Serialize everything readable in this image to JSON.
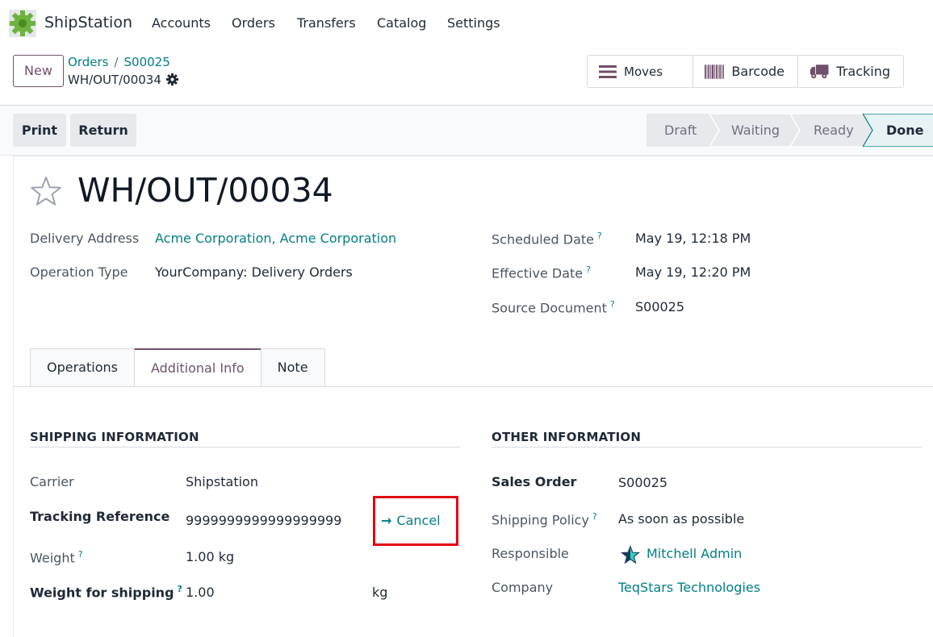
{
  "navbar": {
    "app_name": "ShipStation",
    "menu": [
      "Accounts",
      "Orders",
      "Transfers",
      "Catalog",
      "Settings"
    ]
  },
  "control": {
    "new_label": "New",
    "breadcrumb": [
      "Orders",
      "S00025"
    ],
    "current": "WH/OUT/00034",
    "smart_buttons": [
      "Moves",
      "Barcode",
      "Tracking"
    ]
  },
  "actions": {
    "print": "Print",
    "return": "Return"
  },
  "stages": [
    "Draft",
    "Waiting",
    "Ready",
    "Done"
  ],
  "active_stage": "Done",
  "record": {
    "title": "WH/OUT/00034",
    "delivery_address_label": "Delivery Address",
    "delivery_address": "Acme Corporation, Acme Corporation",
    "operation_type_label": "Operation Type",
    "operation_type": "YourCompany: Delivery Orders",
    "scheduled_date_label": "Scheduled Date",
    "scheduled_date": "May 19, 12:18 PM",
    "effective_date_label": "Effective Date",
    "effective_date": "May 19, 12:20 PM",
    "source_document_label": "Source Document",
    "source_document": "S00025",
    "help_mark": "?"
  },
  "tabs": [
    "Operations",
    "Additional Info",
    "Note"
  ],
  "active_tab": "Additional Info",
  "shipping": {
    "title": "SHIPPING INFORMATION",
    "carrier_label": "Carrier",
    "carrier": "Shipstation",
    "tracking_label": "Tracking Reference",
    "tracking": "9999999999999999999",
    "cancel_label": "Cancel",
    "weight_label": "Weight",
    "weight": "1.00 kg",
    "weight_shipping_label": "Weight for shipping",
    "weight_shipping": "1.00",
    "weight_shipping_unit": "kg"
  },
  "other": {
    "title": "OTHER INFORMATION",
    "sales_order_label": "Sales Order",
    "sales_order": "S00025",
    "shipping_policy_label": "Shipping Policy",
    "shipping_policy": "As soon as possible",
    "responsible_label": "Responsible",
    "responsible": "Mitchell Admin",
    "company_label": "Company",
    "company": "TeqStars Technologies"
  },
  "colors": {
    "brand": "#71506b",
    "link": "#017e84",
    "highlight": "#e30613"
  }
}
